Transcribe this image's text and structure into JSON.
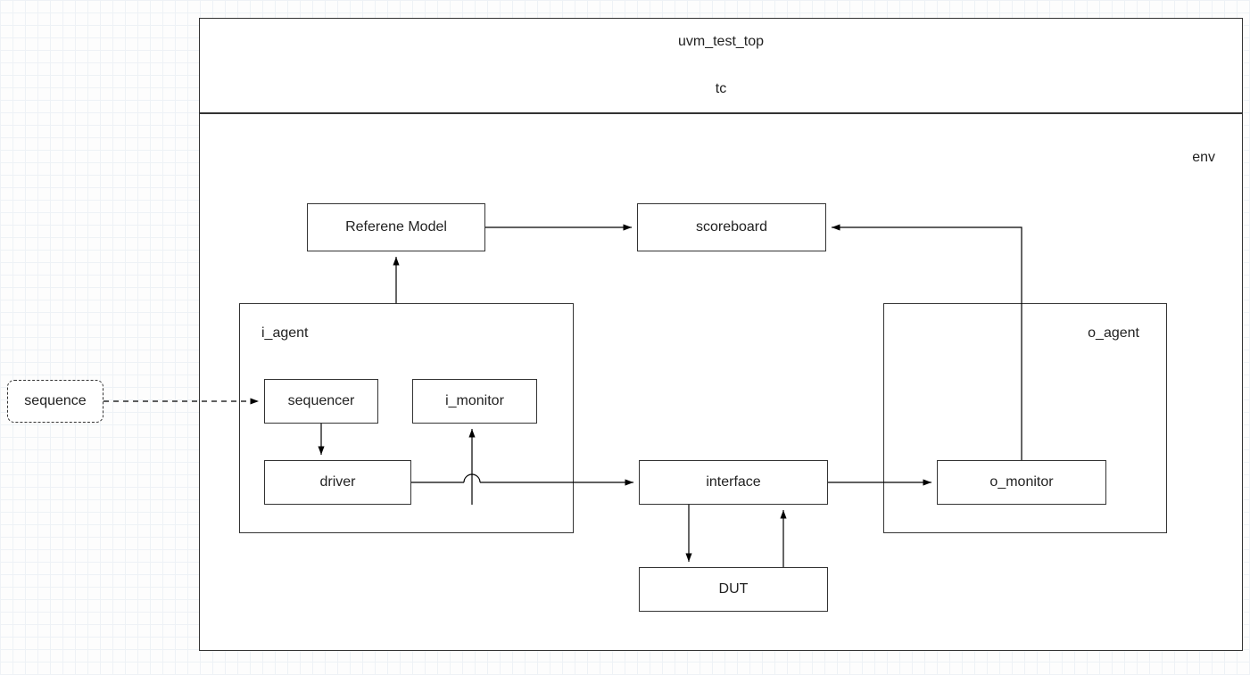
{
  "sequence": "sequence",
  "uvm_test_top": "uvm_test_top",
  "tc": "tc",
  "env": "env",
  "reference_model": "Referene Model",
  "scoreboard": "scoreboard",
  "i_agent": "i_agent",
  "sequencer": "sequencer",
  "i_monitor": "i_monitor",
  "driver": "driver",
  "interface": "interface",
  "o_agent": "o_agent",
  "o_monitor": "o_monitor",
  "dut": "DUT"
}
